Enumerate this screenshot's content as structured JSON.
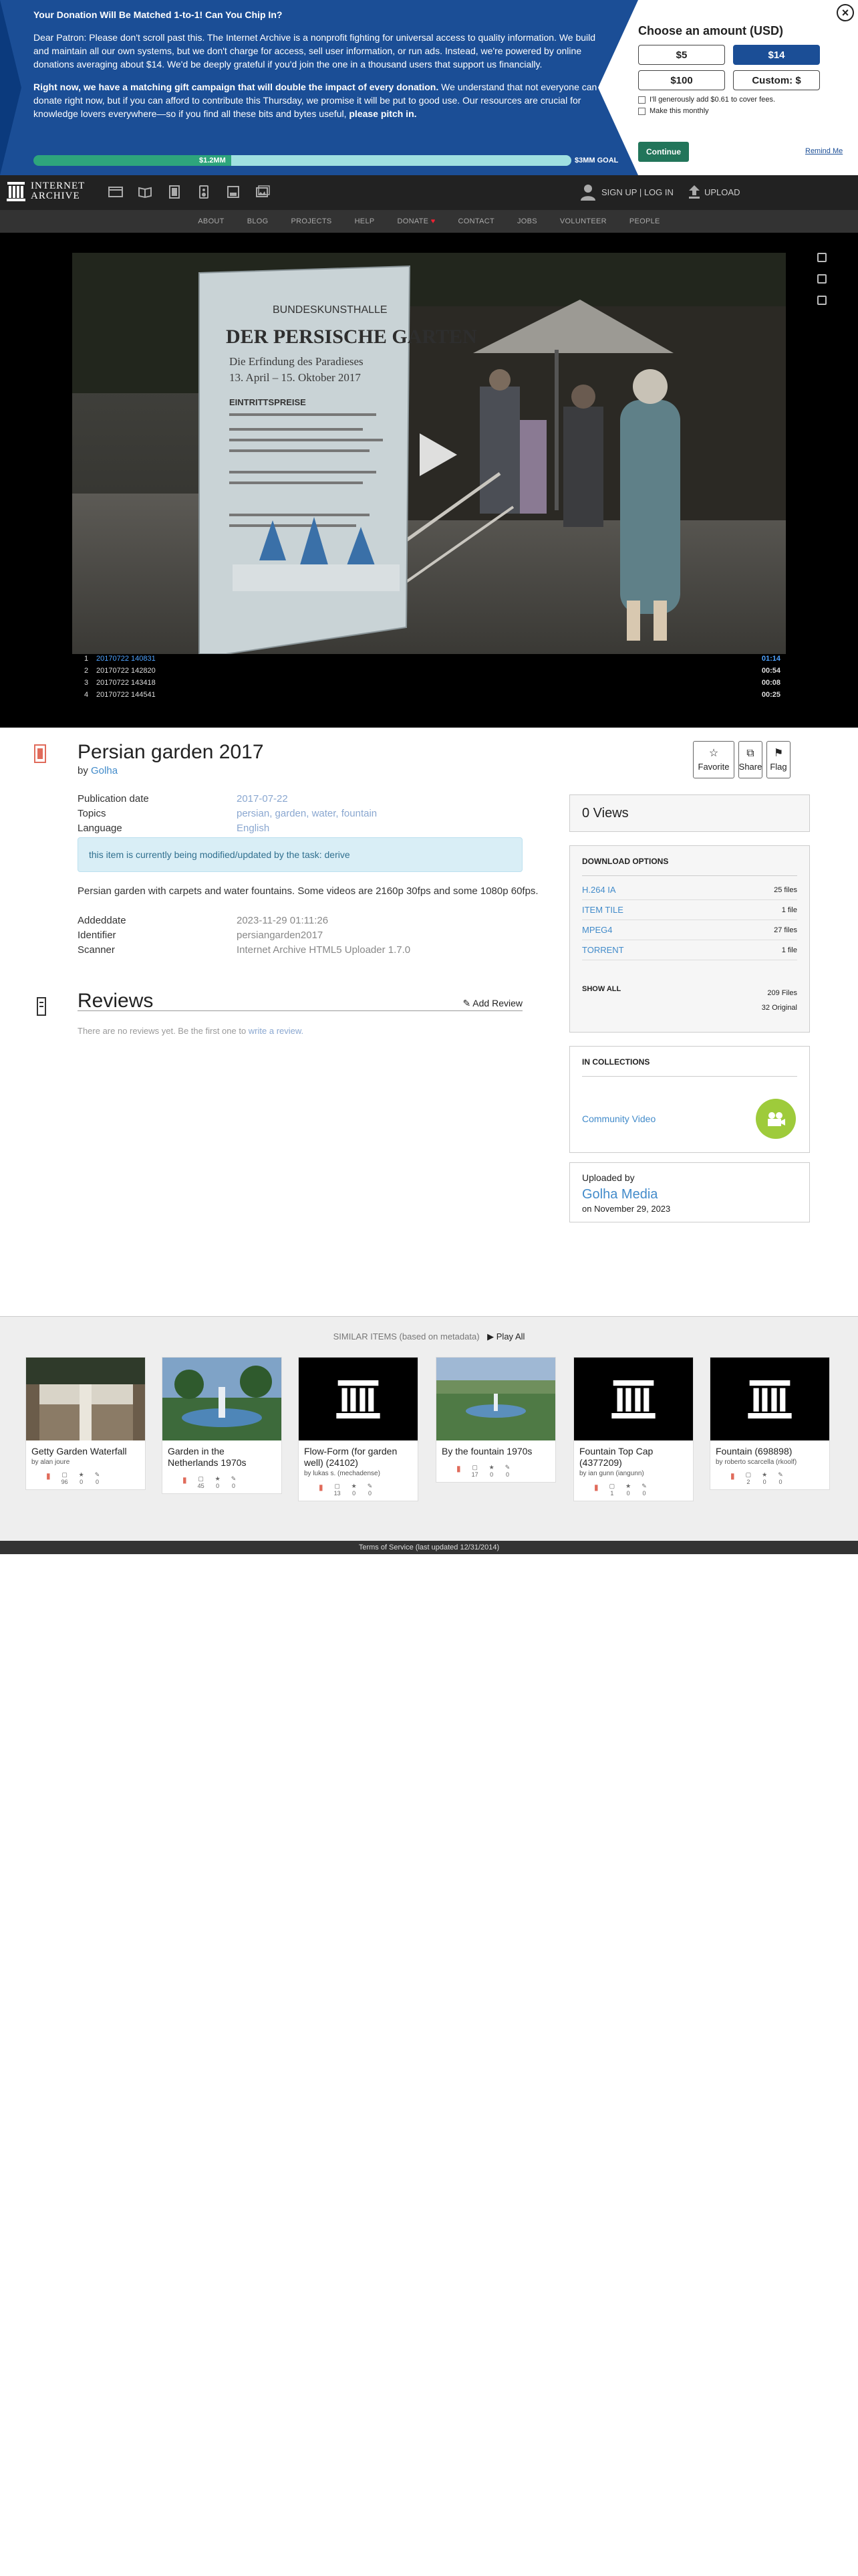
{
  "banner": {
    "heading": "Your Donation Will Be Matched 1-to-1! Can You Chip In?",
    "para1": "Dear Patron: Please don't scroll past this. The Internet Archive is a nonprofit fighting for universal access to quality information. We build and maintain all our own systems, but we don't charge for access, sell user information, or run ads. Instead, we're powered by online donations averaging about $14. We'd be deeply grateful if you'd join the one in a thousand users that support us financially.",
    "para2_bold": "Right now, we have a matching gift campaign that will double the impact of every donation.",
    "para2_rest": " We understand that not everyone can donate right now, but if you can afford to contribute this Thursday, we promise it will be put to good use. Our resources are crucial for knowledge lovers everywhere—so if you find all these bits and bytes useful, ",
    "para2_end": "please pitch in.",
    "raised": "$1.2MM",
    "goal": "$3MM GOAL",
    "progress_fraction": 0.4,
    "panel_title": "Choose an amount (USD)",
    "amounts": [
      "$5",
      "$14",
      "$100",
      "Custom: $"
    ],
    "selected_amount": "$14",
    "cover_fees": "I'll generously add $0.61 to cover fees.",
    "monthly": "Make this monthly",
    "continue": "Continue",
    "remind": "Remind Me",
    "close": "×"
  },
  "nav": {
    "logo_line1": "INTERNET",
    "logo_line2": "ARCHIVE",
    "sign_up": "SIGN UP | LOG IN",
    "upload": "UPLOAD",
    "sub_items": [
      "ABOUT",
      "BLOG",
      "PROJECTS",
      "HELP",
      "DONATE",
      "CONTACT",
      "JOBS",
      "VOLUNTEER",
      "PEOPLE"
    ]
  },
  "player": {
    "playlist": [
      {
        "num": "1",
        "title": "20170722 140831",
        "duration": "01:14"
      },
      {
        "num": "2",
        "title": "20170722 142820",
        "duration": "00:54"
      },
      {
        "num": "3",
        "title": "20170722 143418",
        "duration": "00:08"
      },
      {
        "num": "4",
        "title": "20170722 144541",
        "duration": "00:25"
      }
    ]
  },
  "item": {
    "title": "Persian garden 2017",
    "by_label": "by",
    "creator": "Golha",
    "actions": [
      "Favorite",
      "Share",
      "Flag"
    ],
    "publication_label": "Publication date",
    "publication_date": "2017-07-22",
    "topics_label": "Topics",
    "topics": "persian, garden, water, fountain",
    "language_label": "Language",
    "language": "English",
    "notice": "this item is currently being modified/updated by the task: derive",
    "description": "Persian garden with carpets and water fountains. Some videos are 2160p 30fps and some 1080p 60fps.",
    "addeddate_label": "Addeddate",
    "addeddate": "2023-11-29 01:11:26",
    "identifier_label": "Identifier",
    "identifier": "persiangarden2017",
    "scanner_label": "Scanner",
    "scanner": "Internet Archive HTML5 Uploader 1.7.0",
    "reviews_title": "Reviews",
    "add_review": "Add Review",
    "reviews_empty": "There are no reviews yet. Be the first one to ",
    "reviews_link": "write a review."
  },
  "sidebar": {
    "views": "0 Views",
    "download_title": "DOWNLOAD OPTIONS",
    "downloads": [
      {
        "format": "H.264 IA",
        "count": "25 files"
      },
      {
        "format": "ITEM TILE",
        "count": "1 file"
      },
      {
        "format": "MPEG4",
        "count": "27 files"
      },
      {
        "format": "TORRENT",
        "count": "1 file"
      }
    ],
    "show_all": "SHOW ALL",
    "total_files": "209 Files",
    "original_files": "32 Original",
    "collections_title": "IN COLLECTIONS",
    "collection": "Community Video",
    "uploaded_by_label": "Uploaded by",
    "uploader": "Golha Media",
    "upload_date": "on November 29, 2023"
  },
  "similar": {
    "heading": "SIMILAR ITEMS (based on metadata)",
    "play_all": "Play All",
    "items": [
      {
        "name": "Getty Garden Waterfall",
        "by": "by alan joure",
        "views": "96",
        "favs": "0",
        "reviews": "0",
        "thumb": "photo-waterfall"
      },
      {
        "name": "Garden in the Netherlands 1970s",
        "by": "",
        "views": "45",
        "favs": "0",
        "reviews": "0",
        "thumb": "photo-fountain"
      },
      {
        "name": "Flow-Form (for garden well) (24102)",
        "by": "by lukas s. (mechadense)",
        "views": "13",
        "favs": "0",
        "reviews": "0",
        "thumb": "archive-icon"
      },
      {
        "name": "By the fountain 1970s",
        "by": "",
        "views": "17",
        "favs": "0",
        "reviews": "0",
        "thumb": "photo-park"
      },
      {
        "name": "Fountain Top Cap (4377209)",
        "by": "by ian gunn (iangunn)",
        "views": "1",
        "favs": "0",
        "reviews": "0",
        "thumb": "archive-icon"
      },
      {
        "name": "Fountain (698898)",
        "by": "by roberto scarcella (rkoolf)",
        "views": "2",
        "favs": "0",
        "reviews": "0",
        "thumb": "archive-icon"
      }
    ]
  },
  "footer": "Terms of Service (last updated 12/31/2014)",
  "colors": {
    "banner_blue": "#1b4e96",
    "link_blue": "#428bca",
    "continue_green": "#22755a",
    "collection_green": "#9ecb3b"
  }
}
